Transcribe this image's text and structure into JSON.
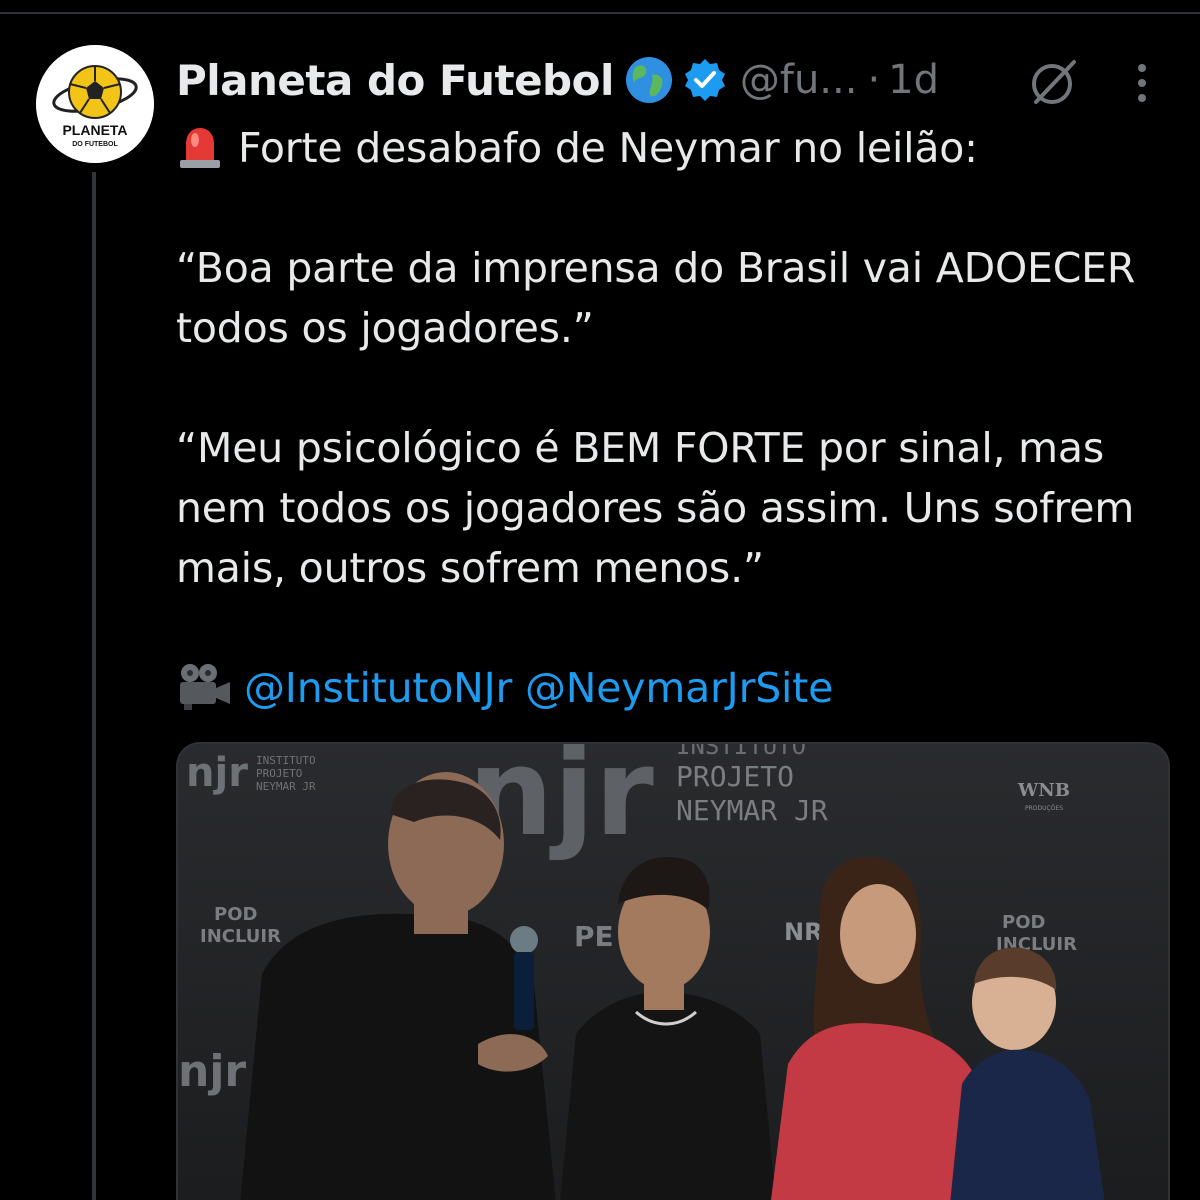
{
  "author": {
    "display_name": "Planeta do Futebol",
    "handle": "@fu...",
    "separator": "·",
    "time": "1d",
    "avatar_text_line1": "PLANETA",
    "avatar_text_line2": "DO FUTEBOL"
  },
  "tweet": {
    "line1": "Forte desabafo de Neymar no leilão:",
    "quote1": "“Boa parte da imprensa do Brasil vai ADOECER todos os jogadores.”",
    "quote2": "“Meu psicológico é BEM FORTE por sinal, mas nem todos os jogadores são assim. Uns sofrem mais, outros sofrem menos.”",
    "mention1": "@InstitutoNJr",
    "mention2": "@NeymarJrSite"
  },
  "media": {
    "logo_small_line1": "INSTITUTO",
    "logo_small_line2": "PROJETO",
    "logo_small_line3": "NEYMAR JR",
    "logo_big_line1": "INSTITUTO",
    "logo_big_line2": "PROJETO",
    "logo_big_line3": "NEYMAR JR",
    "wnb": "WNB",
    "wnb_sub": "PRODUÇÕES",
    "pod1": "POD",
    "pod2": "INCLUIR",
    "monogram": "njr",
    "pe": "PE",
    "nr": "NR"
  },
  "colors": {
    "background": "#000000",
    "text": "#e7e9ea",
    "muted": "#71767b",
    "link": "#1d9bf0",
    "verified": "#1d9bf0"
  },
  "icons": [
    "globe-icon",
    "verified-icon",
    "grok-icon",
    "more-icon",
    "siren-icon",
    "camera-icon"
  ]
}
